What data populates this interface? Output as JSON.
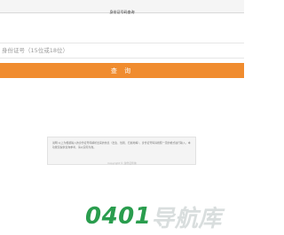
{
  "header": {
    "title": "身份证号码查询"
  },
  "search": {
    "placeholder": "身份证号（15位或18位）",
    "value": ""
  },
  "actions": {
    "query_label": "查 询"
  },
  "notice": {
    "text": "说明:以上为根据输入的身份证号码解析出来的信息（出生、性别、归属地等），身份证号码请按照一定的格式进行输入，本功能仅提供查询参考，请以实际为准。"
  },
  "footer": {
    "copyright": "Copyright © 身份证查询"
  },
  "watermark": {
    "digits": "0401",
    "cjk": "导航库"
  },
  "colors": {
    "accent": "#f08c2f",
    "watermark_green": "#2a9d4e"
  }
}
